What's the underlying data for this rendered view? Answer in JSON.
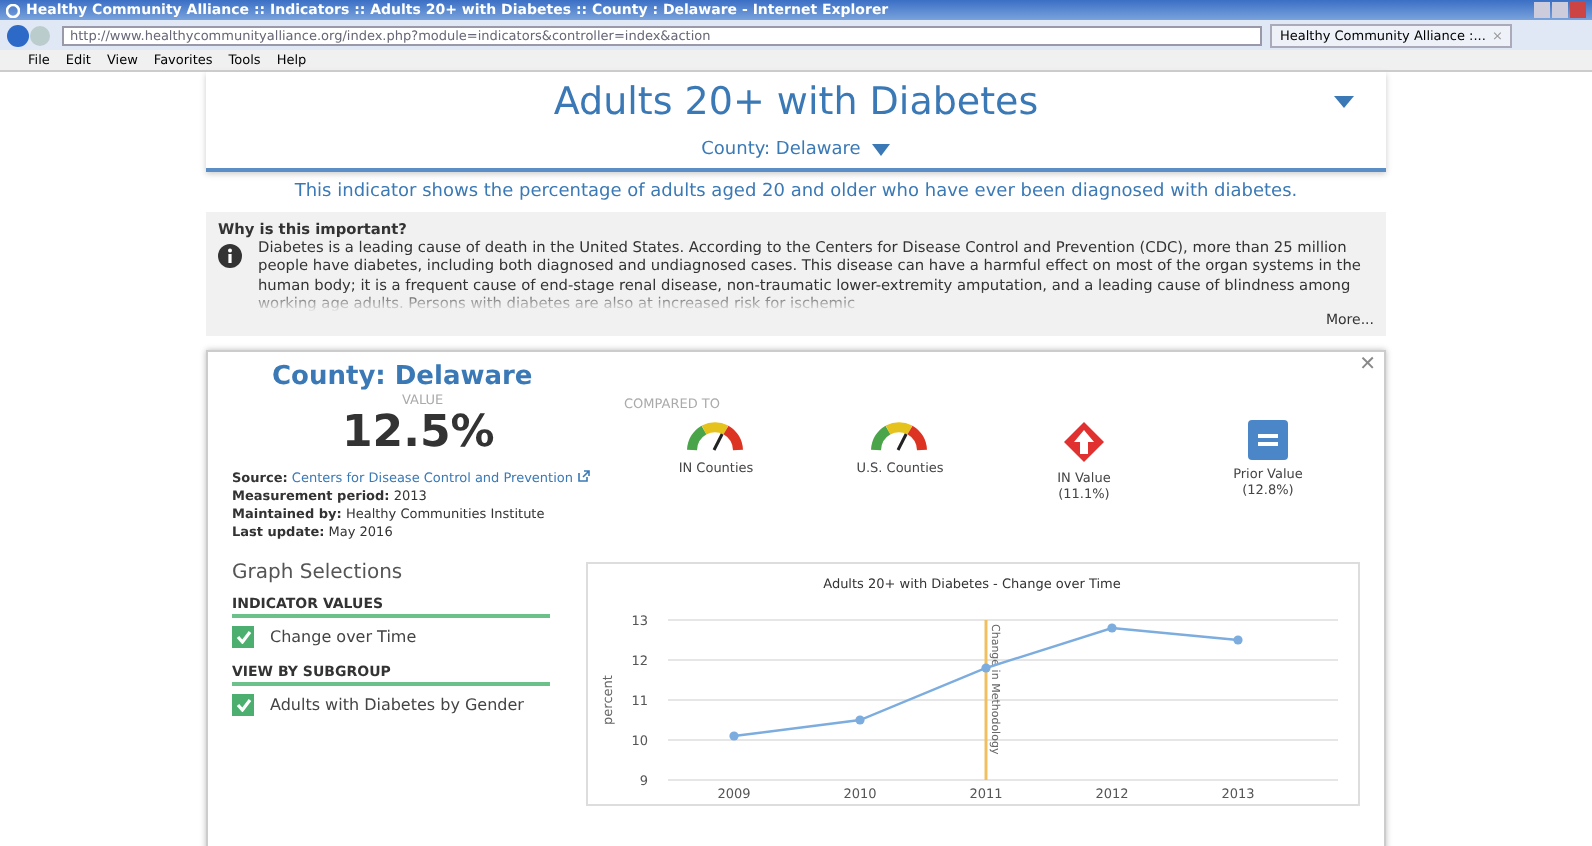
{
  "window": {
    "title": "Healthy Community Alliance :: Indicators :: Adults 20+ with Diabetes :: County : Delaware - Internet Explorer"
  },
  "address_bar": {
    "url": "http://www.healthycommunityalliance.org/index.php?module=indicators&controller=index&action"
  },
  "browser_tab": {
    "label": "Healthy Community Alliance :...",
    "close": "×"
  },
  "menu": [
    "File",
    "Edit",
    "View",
    "Favorites",
    "Tools",
    "Help"
  ],
  "indicator": {
    "title": "Adults 20+ with Diabetes",
    "location": "County: Delaware",
    "description": "This indicator shows the percentage of adults aged 20 and older who have ever been diagnosed with diabetes."
  },
  "importance": {
    "heading": "Why is this important?",
    "text": "Diabetes is a leading cause of death in the United States. According to the Centers for Disease Control and Prevention (CDC), more than 25 million people have diabetes, including both diagnosed and undiagnosed cases. This disease can have a harmful effect on most of the organ systems in the human body; it is a frequent cause of end-stage renal disease, non-traumatic lower-extremity amputation, and a leading cause of blindness among working age adults. Persons with diabetes are also at increased risk for ischemic",
    "more": "More..."
  },
  "card": {
    "close": "✕",
    "title": "County: Delaware",
    "value_label": "VALUE",
    "value": "12.5%",
    "compared_label": "COMPARED TO",
    "comparisons": [
      {
        "kind": "gauge",
        "label": "IN Counties"
      },
      {
        "kind": "gauge",
        "label": "U.S. Counties"
      },
      {
        "kind": "worse",
        "label": "IN Value",
        "detail": "(11.1%)"
      },
      {
        "kind": "same",
        "label": "Prior Value",
        "detail": "(12.8%)"
      }
    ],
    "meta": [
      {
        "label": "Source:",
        "value": "Centers for Disease Control and Prevention",
        "link": true
      },
      {
        "label": "Measurement period:",
        "value": "2013",
        "link": false
      },
      {
        "label": "Maintained by:",
        "value": "Healthy Communities Institute",
        "link": false
      },
      {
        "label": "Last update:",
        "value": "May 2016",
        "link": false
      }
    ],
    "graph_selections": {
      "title": "Graph Selections",
      "groups": [
        {
          "heading": "INDICATOR VALUES",
          "options": [
            {
              "label": "Change over Time",
              "checked": true
            }
          ]
        },
        {
          "heading": "VIEW BY SUBGROUP",
          "options": [
            {
              "label": "Adults with Diabetes by Gender",
              "checked": true
            }
          ]
        }
      ]
    },
    "chart_data": {
      "type": "line",
      "title": "Adults 20+ with Diabetes - Change over Time",
      "ylabel": "percent",
      "categories": [
        "2009",
        "2010",
        "2011",
        "2012",
        "2013"
      ],
      "series": [
        {
          "color": "#7cadde",
          "marker": "circle",
          "values": [
            10.1,
            10.5,
            11.8,
            12.8,
            12.5
          ]
        }
      ],
      "ylim": [
        9,
        13
      ],
      "yticks": [
        9,
        10,
        11,
        12,
        13
      ],
      "grid": true,
      "ref_lines": [
        {
          "axis": "x",
          "value": "2011",
          "label": "Change in Methodology",
          "color": "#f0c060"
        }
      ]
    }
  }
}
